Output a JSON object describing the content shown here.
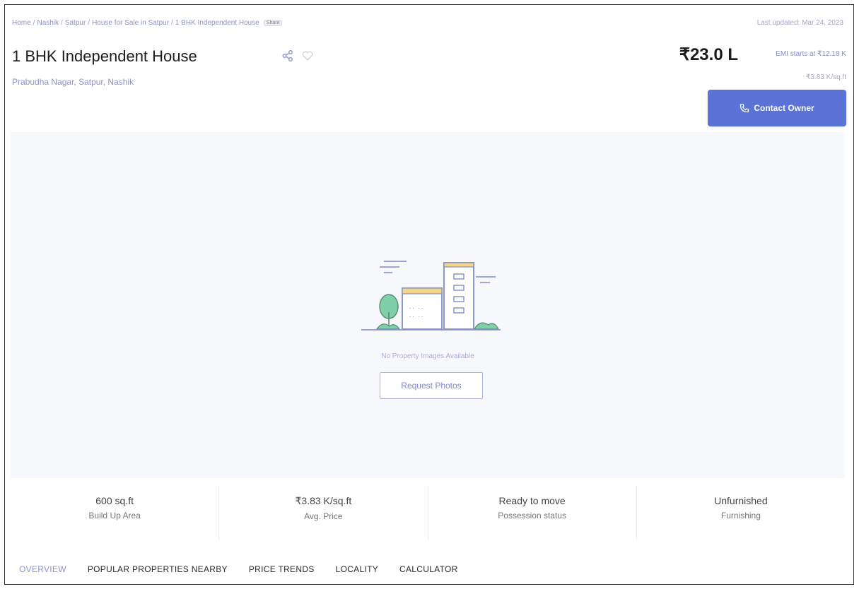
{
  "breadcrumb": {
    "items": [
      "Home",
      "Nashik",
      "Satpur",
      "House for Sale in Satpur",
      "1 BHK Independent House"
    ],
    "badge": "Share"
  },
  "last_updated": "Last updated: Mar 24, 2023",
  "listing": {
    "title": "1 BHK Independent House",
    "location": "Prabudha Nagar, Satpur, Nashik"
  },
  "pricing": {
    "price": "₹23.0 L",
    "emi": "EMI starts at ₹12.18 K",
    "per_sqft": "₹3.83 K/sq.ft"
  },
  "contact_button": {
    "label": "Contact Owner",
    "icon": "phone-icon"
  },
  "icons": {
    "share": "share-icon",
    "wishlist": "heart-icon",
    "placeholder": "building-illustration"
  },
  "gallery": {
    "empty_text": "No Property Images Available",
    "request_button": "Request Photos"
  },
  "stats": [
    {
      "value": "600 sq.ft",
      "label": "Build Up Area"
    },
    {
      "value": "₹3.83 K/sq.ft",
      "label": "Avg. Price"
    },
    {
      "value": "Ready to move",
      "label": "Possession status"
    },
    {
      "value": "Unfurnished",
      "label": "Furnishing"
    }
  ],
  "tabs": [
    {
      "label": "OVERVIEW",
      "active": true
    },
    {
      "label": "POPULAR PROPERTIES NEARBY",
      "active": false
    },
    {
      "label": "PRICE TRENDS",
      "active": false
    },
    {
      "label": "LOCALITY",
      "active": false
    },
    {
      "label": "CALCULATOR",
      "active": false
    }
  ],
  "colors": {
    "accent": "#5b73d6",
    "link": "#8a93c4",
    "muted": "#a3a8c8"
  }
}
